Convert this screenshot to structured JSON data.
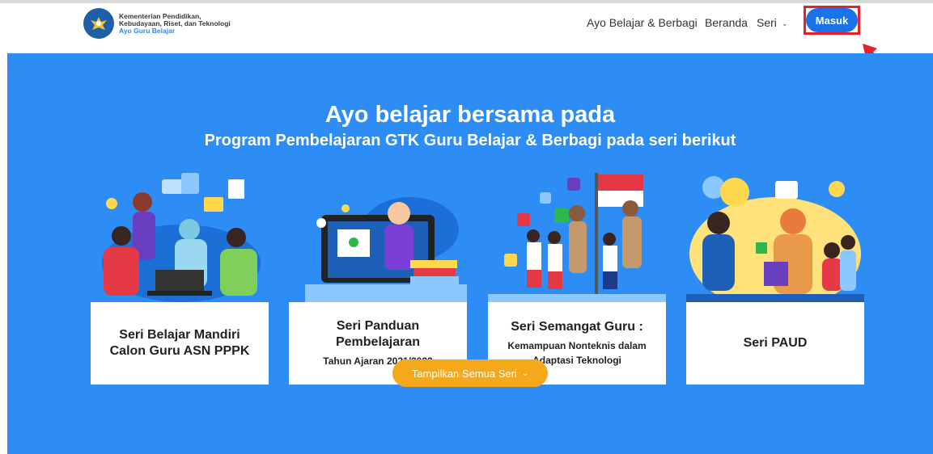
{
  "header": {
    "logo_line1": "Kementerian Pendidikan,",
    "logo_line2": "Kebudayaan, Riset, dan Teknologi",
    "logo_line3": "Ayo Guru Belajar",
    "nav": [
      "Ayo Belajar & Berbagi",
      "Beranda",
      "Seri"
    ],
    "login_label": "Masuk"
  },
  "hero": {
    "title": "Ayo belajar bersama pada",
    "subtitle": "Program Pembelajaran GTK Guru Belajar & Berbagi pada seri berikut",
    "cards": [
      {
        "title": "Seri Belajar Mandiri Calon Guru ASN PPPK",
        "subtitle": ""
      },
      {
        "title": "Seri Panduan Pembelajaran",
        "subtitle": "Tahun Ajaran 2021/2022"
      },
      {
        "title": "Seri Semangat Guru :",
        "subtitle": "Kemampuan Nonteknis dalam Adaptasi Teknologi"
      },
      {
        "title": "Seri PAUD",
        "subtitle": ""
      }
    ],
    "show_all_label": "Tampilkan Semua Seri"
  },
  "colors": {
    "hero_bg": "#2d8df5",
    "login_button": "#1a73e8",
    "highlight": "#e8202a",
    "show_all_button": "#f4a81a"
  }
}
